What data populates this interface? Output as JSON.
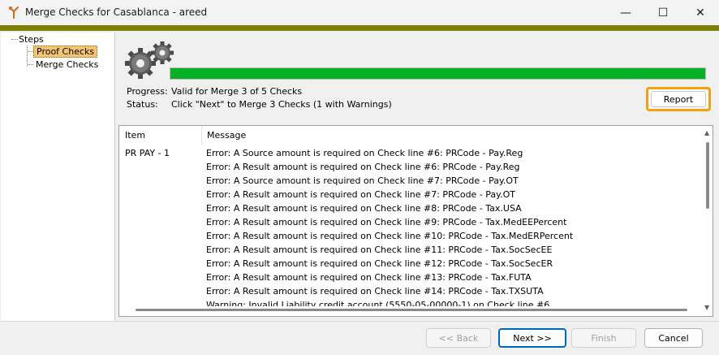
{
  "window": {
    "title": "Merge Checks for Casablanca - areed",
    "minimize_glyph": "—",
    "maximize_glyph": "☐",
    "close_glyph": "✕"
  },
  "tree": {
    "root": "Steps",
    "items": [
      {
        "label": "Proof Checks",
        "selected": true
      },
      {
        "label": "Merge Checks",
        "selected": false
      }
    ]
  },
  "progress": {
    "percent": 100,
    "color": "#06b025",
    "progress_label": "Progress:",
    "progress_value": "Valid for Merge 3 of 5 Checks",
    "status_label": "Status:",
    "status_value": "Click \"Next\" to Merge 3 Checks (1 with Warnings)"
  },
  "report_button": "Report",
  "list": {
    "headers": {
      "item": "Item",
      "message": "Message"
    },
    "item": "PR PAY - 1",
    "messages": [
      "Error: A Source amount is required on Check line #6: PRCode - Pay.Reg",
      "Error: A Result amount is required on Check line #6: PRCode - Pay.Reg",
      "Error: A Source amount is required on Check line #7: PRCode - Pay.OT",
      "Error: A Result amount is required on Check line #7: PRCode - Pay.OT",
      "Error: A Result amount is required on Check line #8: PRCode - Tax.USA",
      "Error: A Result amount is required on Check line #9: PRCode - Tax.MedEEPercent",
      "Error: A Result amount is required on Check line #10: PRCode - Tax.MedERPercent",
      "Error: A Result amount is required on Check line #11: PRCode - Tax.SocSecEE",
      "Error: A Result amount is required on Check line #12: PRCode - Tax.SocSecER",
      "Error: A Result amount is required on Check line #13: PRCode - Tax.FUTA",
      "Error: A Result amount is required on Check line #14: PRCode - Tax.TXSUTA"
    ],
    "partial_message": "Warning: Invalid Liability credit account (5550-05-00000-1) on Check line #6"
  },
  "footer": {
    "back": "<< Back",
    "next": "Next >>",
    "finish": "Finish",
    "cancel": "Cancel"
  },
  "colors": {
    "accent_olive": "#7f7f00",
    "report_highlight": "#f5a10f",
    "tree_selection": "#f7c572"
  }
}
